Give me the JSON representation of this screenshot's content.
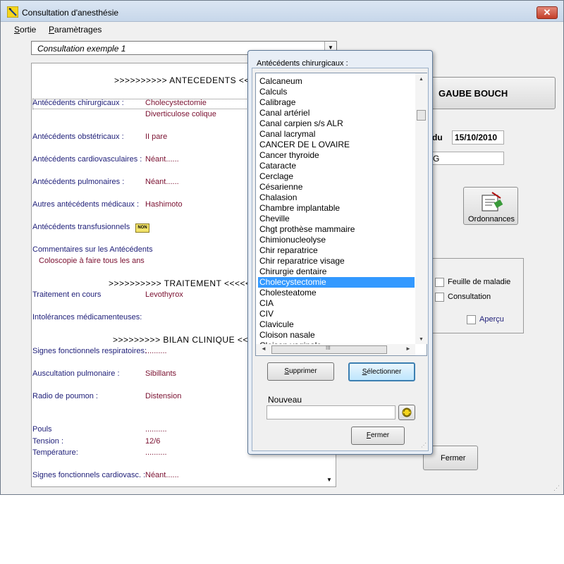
{
  "window": {
    "title": "Consultation d'anesthésie",
    "close_glyph": "✕"
  },
  "menu": {
    "items": [
      {
        "first": "S",
        "rest": "ortie"
      },
      {
        "first": "P",
        "rest": "aramètrages"
      }
    ]
  },
  "consultation_combo": {
    "value": "Consultation exemple 1",
    "arrow": "▼"
  },
  "document": {
    "sections": {
      "antecedents": ">>>>>>>>>>   ANTECEDENTS    <<<<",
      "traitement": ">>>>>>>>>>  TRAITEMENT    <<<<<<<<",
      "bilan": ">>>>>>>>>  BILAN CLINIQUE    <<<<<"
    },
    "rows": [
      {
        "label": "Antécédents chirurgicaux :",
        "value": "Cholecystectomie"
      },
      {
        "label": "",
        "value": "Diverticulose colique"
      },
      {
        "label": "Antécédents obstétricaux   :",
        "value": "II pare"
      },
      {
        "label": "Antécédents cardiovasculaires :",
        "value": "Néant......"
      },
      {
        "label": "Antécédents pulmonaires :",
        "value": "Néant......"
      },
      {
        "label": "Autres antécédents médicaux  :",
        "value": "Hashimoto"
      },
      {
        "label": "Antécédents transfusionnels",
        "value": ""
      },
      {
        "label": "Commentaires sur les Antécédents",
        "value": ""
      },
      {
        "label": "Coloscopie à faire tous les ans",
        "value": ""
      },
      {
        "label": "Traitement en cours",
        "value": "Levothyrox"
      },
      {
        "label": "Intolérances médicamenteuses:",
        "value": ""
      },
      {
        "label": "Signes fonctionnels respiratoires:",
        "value": ".........."
      },
      {
        "label": "Auscultation pulmonaire :",
        "value": "Sibillants"
      },
      {
        "label": "Radio de poumon :",
        "value": "Distension"
      },
      {
        "label": "Pouls",
        "value": ".........."
      },
      {
        "label": "Tension :",
        "value": "12/6"
      },
      {
        "label": "Température:",
        "value": ".........."
      },
      {
        "label": "Signes fonctionnels cardiovasc. :",
        "value": "Néant......"
      }
    ],
    "non_badge": "NON"
  },
  "patient": {
    "name": "GAUBE BOUCH"
  },
  "date": {
    "label": "du",
    "value": "15/10/2010"
  },
  "g_field": {
    "value": "G"
  },
  "ordonnances": {
    "label": "Ordonnances"
  },
  "print_options": {
    "feuille_label": "Feuille de maladie",
    "consultation_label": "Consultation",
    "apercu_label": "Aperçu"
  },
  "main_fermer": {
    "label": "Fermer"
  },
  "dialog": {
    "title": "Antécédents chirurgicaux :",
    "items": [
      "Calcaneum",
      "Calculs",
      "Calibrage",
      "Canal artériel",
      "Canal carpien s/s ALR",
      "Canal lacrymal",
      "CANCER DE L OVAIRE",
      "Cancer thyroide",
      "Cataracte",
      "Cerclage",
      "Césarienne",
      "Chalasion",
      "Chambre implantable",
      "Cheville",
      "Chgt prothèse mammaire",
      "Chimionucleolyse",
      "Chir reparatrice",
      "Chir reparatrice visage",
      "Chirurgie dentaire",
      "Cholecystectomie",
      "Cholesteatome",
      "CIA",
      "CIV",
      "Clavicule",
      "Cloison nasale",
      "Cloison vaginale"
    ],
    "selected_item": "Cholecystectomie",
    "supprimer": {
      "first": "S",
      "rest": "upprimer"
    },
    "selectionner": {
      "first": "S",
      "rest": "électionner"
    },
    "nouveau_label": "Nouveau",
    "nouveau_value": "",
    "fermer": {
      "first": "F",
      "rest": "ermer"
    },
    "scroll_glyphs": {
      "up": "▲",
      "down": "▼",
      "left": "◄",
      "right": "►",
      "grip": "III"
    }
  }
}
